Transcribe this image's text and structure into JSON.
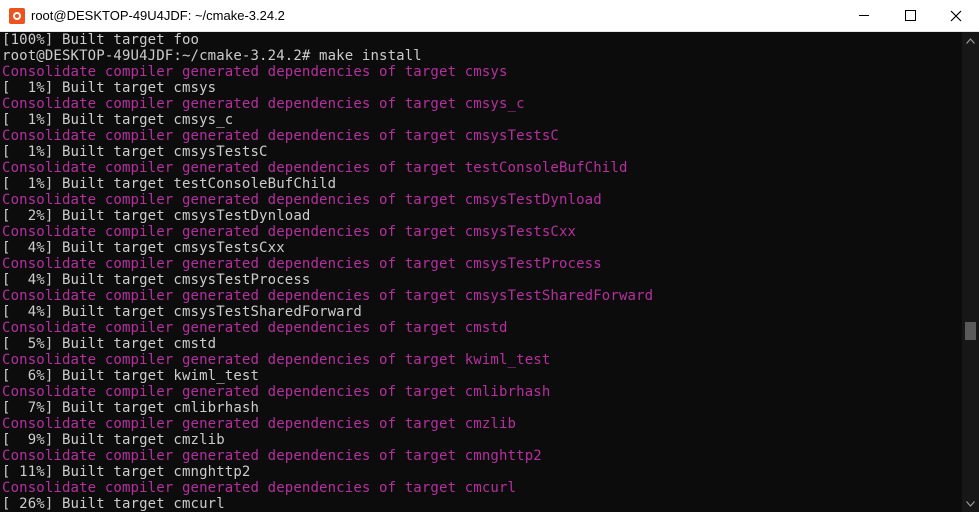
{
  "window": {
    "title": "root@DESKTOP-49U4JDF: ~/cmake-3.24.2",
    "app_icon": "ubuntu-icon",
    "controls": [
      "minimize-icon",
      "maximize-icon",
      "close-icon"
    ]
  },
  "colors": {
    "background": "#0c0c0c",
    "text": "#cccccc",
    "magenta": "#b62fa0",
    "scrollbar": "#171717",
    "thumb": "#5a5a5a"
  },
  "terminal": {
    "lines": [
      {
        "text": "[100%] Built target foo",
        "style": "normal"
      },
      {
        "text": "root@DESKTOP-49U4JDF:~/cmake-3.24.2# make install",
        "style": "normal"
      },
      {
        "text": "Consolidate compiler generated dependencies of target cmsys",
        "style": "magenta"
      },
      {
        "text": "[  1%] Built target cmsys",
        "style": "normal"
      },
      {
        "text": "Consolidate compiler generated dependencies of target cmsys_c",
        "style": "magenta"
      },
      {
        "text": "[  1%] Built target cmsys_c",
        "style": "normal"
      },
      {
        "text": "Consolidate compiler generated dependencies of target cmsysTestsC",
        "style": "magenta"
      },
      {
        "text": "[  1%] Built target cmsysTestsC",
        "style": "normal"
      },
      {
        "text": "Consolidate compiler generated dependencies of target testConsoleBufChild",
        "style": "magenta"
      },
      {
        "text": "[  1%] Built target testConsoleBufChild",
        "style": "normal"
      },
      {
        "text": "Consolidate compiler generated dependencies of target cmsysTestDynload",
        "style": "magenta"
      },
      {
        "text": "[  2%] Built target cmsysTestDynload",
        "style": "normal"
      },
      {
        "text": "Consolidate compiler generated dependencies of target cmsysTestsCxx",
        "style": "magenta"
      },
      {
        "text": "[  4%] Built target cmsysTestsCxx",
        "style": "normal"
      },
      {
        "text": "Consolidate compiler generated dependencies of target cmsysTestProcess",
        "style": "magenta"
      },
      {
        "text": "[  4%] Built target cmsysTestProcess",
        "style": "normal"
      },
      {
        "text": "Consolidate compiler generated dependencies of target cmsysTestSharedForward",
        "style": "magenta"
      },
      {
        "text": "[  4%] Built target cmsysTestSharedForward",
        "style": "normal"
      },
      {
        "text": "Consolidate compiler generated dependencies of target cmstd",
        "style": "magenta"
      },
      {
        "text": "[  5%] Built target cmstd",
        "style": "normal"
      },
      {
        "text": "Consolidate compiler generated dependencies of target kwiml_test",
        "style": "magenta"
      },
      {
        "text": "[  6%] Built target kwiml_test",
        "style": "normal"
      },
      {
        "text": "Consolidate compiler generated dependencies of target cmlibrhash",
        "style": "magenta"
      },
      {
        "text": "[  7%] Built target cmlibrhash",
        "style": "normal"
      },
      {
        "text": "Consolidate compiler generated dependencies of target cmzlib",
        "style": "magenta"
      },
      {
        "text": "[  9%] Built target cmzlib",
        "style": "normal"
      },
      {
        "text": "Consolidate compiler generated dependencies of target cmnghttp2",
        "style": "magenta"
      },
      {
        "text": "[ 11%] Built target cmnghttp2",
        "style": "normal"
      },
      {
        "text": "Consolidate compiler generated dependencies of target cmcurl",
        "style": "magenta"
      },
      {
        "text": "[ 26%] Built target cmcurl",
        "style": "normal"
      }
    ]
  }
}
